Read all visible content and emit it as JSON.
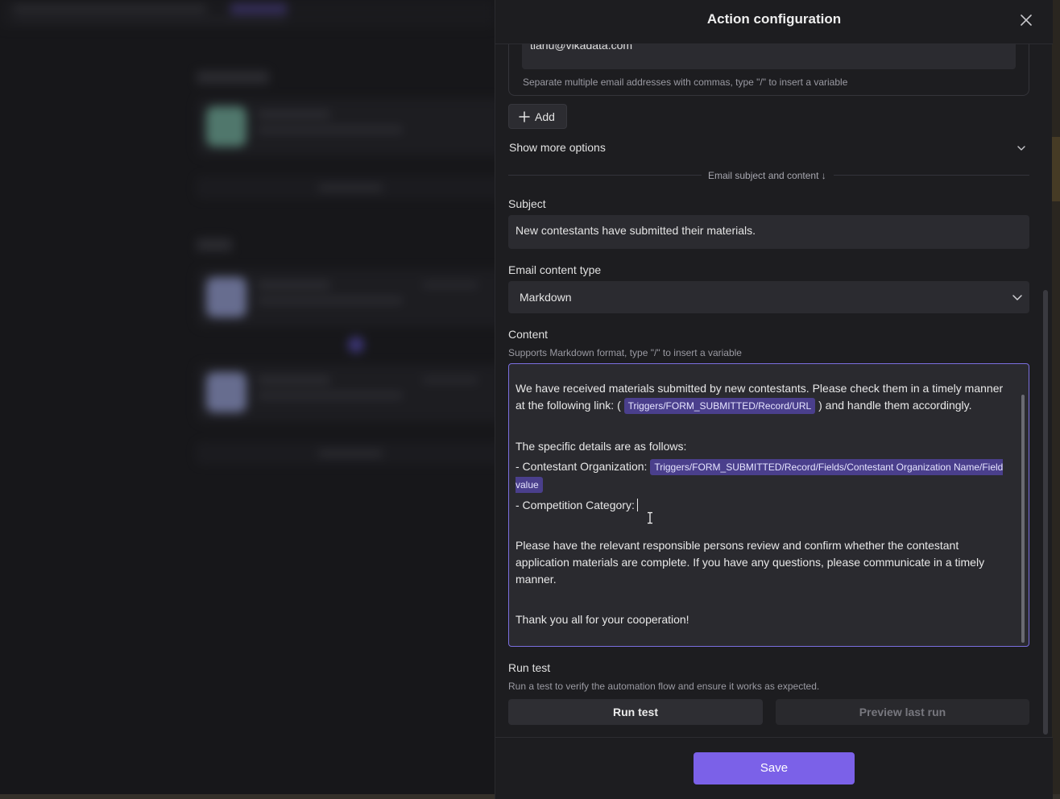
{
  "drawer": {
    "title": "Action configuration"
  },
  "recipients": {
    "email_value": "tianu@vikadata.com",
    "hint": "Separate multiple email addresses with commas, type \"/\" to insert a variable",
    "add_label": "Add"
  },
  "options": {
    "show_more_label": "Show more options"
  },
  "section": {
    "divider_label": "Email subject and content ↓"
  },
  "subject": {
    "label": "Subject",
    "value": "New contestants have submitted their materials."
  },
  "content_type": {
    "label": "Email content type",
    "selected": "Markdown"
  },
  "content": {
    "label": "Content",
    "hint": "Supports Markdown format, type \"/\" to insert a variable",
    "para1_before": "We have received materials submitted by new contestants. Please check them in a timely manner at the following link: (",
    "var_url": "Triggers/FORM_SUBMITTED/Record/URL",
    "para1_after": ") and handle them accordingly.",
    "details_intro": "The specific details are as follows:",
    "org_label": "- Contestant Organization:",
    "var_org": "Triggers/FORM_SUBMITTED/Record/Fields/Contestant Organization Name/Field value",
    "category_label": "- Competition Category:",
    "para_review": "Please have the relevant responsible persons review and confirm whether the contestant application materials are complete. If you have any questions, please communicate in a timely manner.",
    "para_thanks": "Thank you all for your cooperation!"
  },
  "run_test": {
    "title": "Run test",
    "hint": "Run a test to verify the automation flow and ensure it works as expected.",
    "run_label": "Run test",
    "preview_label": "Preview last run"
  },
  "footer": {
    "save_label": "Save"
  },
  "colors": {
    "accent": "#7b61e8",
    "variable_chip": "#4a3f8c",
    "editor_focus_border": "#7b6fe0"
  }
}
